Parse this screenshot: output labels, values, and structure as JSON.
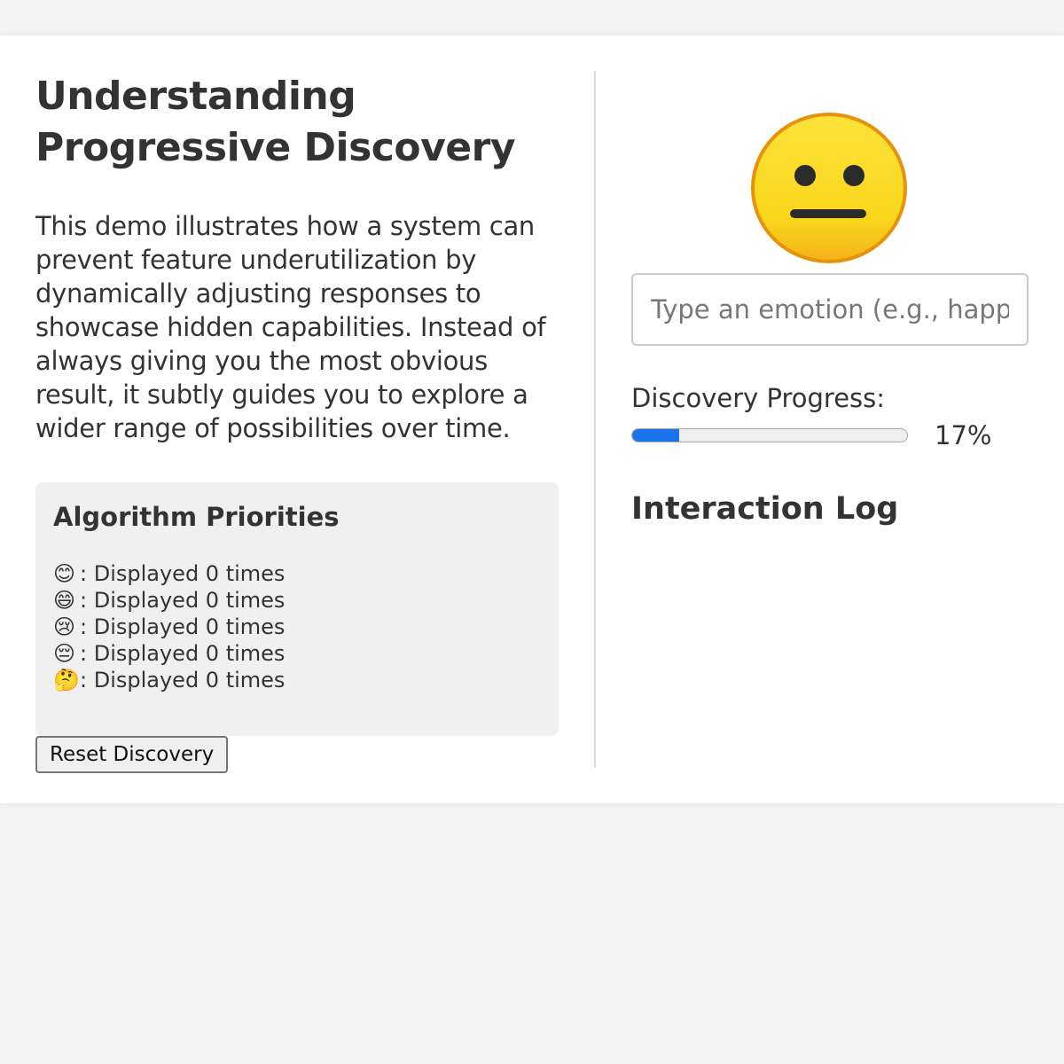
{
  "left": {
    "title": "Understanding Progressive Discovery",
    "description": "This demo illustrates how a system can prevent feature underutilization by dynamically adjusting responses to showcase hidden capabilities. Instead of always giving you the most obvious result, it subtly guides you to explore a wider range of possibilities over time.",
    "priorities": {
      "heading": "Algorithm Priorities",
      "items": [
        {
          "emoji": "😊",
          "text": ": Displayed 0 times"
        },
        {
          "emoji": "😄",
          "text": ": Displayed 0 times"
        },
        {
          "emoji": "😢",
          "text": ": Displayed 0 times"
        },
        {
          "emoji": "😔",
          "text": ": Displayed 0 times"
        },
        {
          "emoji": "🤔",
          "text": ": Displayed 0 times"
        }
      ]
    },
    "reset_label": "Reset Discovery"
  },
  "right": {
    "current_emoji": "neutral-face-icon",
    "input_placeholder": "Type an emotion (e.g., happy, sad)",
    "progress_label": "Discovery Progress:",
    "progress_percent": 17,
    "progress_text": "17%",
    "log_title": "Interaction Log"
  },
  "colors": {
    "accent": "#1a73e8",
    "face_yellow": "#f9d71c",
    "face_outline": "#e8920b"
  }
}
